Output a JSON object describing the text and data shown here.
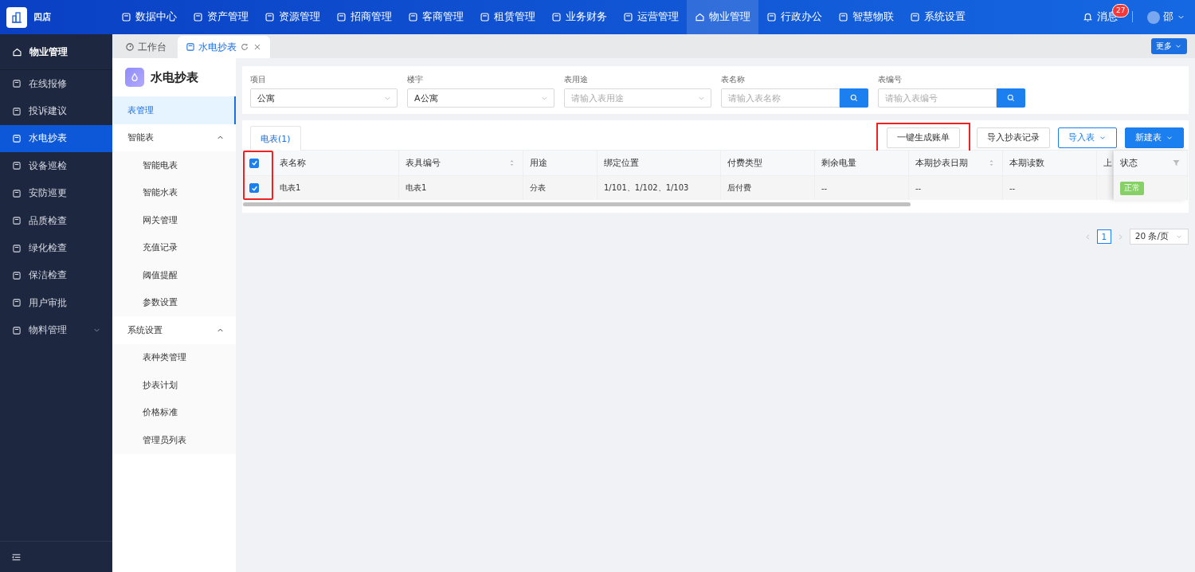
{
  "brand": {
    "name": "四店"
  },
  "top_nav": [
    {
      "label": "数据中心",
      "selected": false
    },
    {
      "label": "资产管理",
      "selected": false
    },
    {
      "label": "资源管理",
      "selected": false
    },
    {
      "label": "招商管理",
      "selected": false
    },
    {
      "label": "客商管理",
      "selected": false
    },
    {
      "label": "租赁管理",
      "selected": false
    },
    {
      "label": "业务财务",
      "selected": false
    },
    {
      "label": "运营管理",
      "selected": false
    },
    {
      "label": "物业管理",
      "selected": true
    },
    {
      "label": "行政办公",
      "selected": false
    },
    {
      "label": "智慧物联",
      "selected": false
    },
    {
      "label": "系统设置",
      "selected": false
    }
  ],
  "notifications": {
    "label": "消息",
    "count": "27"
  },
  "user": {
    "name": "邵"
  },
  "sidebar": {
    "title": "物业管理",
    "items": [
      {
        "label": "在线报修",
        "selected": false
      },
      {
        "label": "投诉建议",
        "selected": false
      },
      {
        "label": "水电抄表",
        "selected": true
      },
      {
        "label": "设备巡检",
        "selected": false
      },
      {
        "label": "安防巡更",
        "selected": false
      },
      {
        "label": "品质检查",
        "selected": false
      },
      {
        "label": "绿化检查",
        "selected": false
      },
      {
        "label": "保洁检查",
        "selected": false
      },
      {
        "label": "用户审批",
        "selected": false
      },
      {
        "label": "物料管理",
        "selected": false,
        "expanded": false
      }
    ]
  },
  "page_tabs": [
    {
      "label": "工作台",
      "selected": false
    },
    {
      "label": "水电抄表",
      "selected": true
    }
  ],
  "more_button": "更多",
  "submenu": {
    "title": "水电抄表",
    "items": [
      {
        "label": "表管理",
        "selected": true
      },
      {
        "label": "智能表",
        "selected": false,
        "expanded": true,
        "children": [
          {
            "label": "智能电表",
            "selected": false
          },
          {
            "label": "智能水表",
            "selected": false
          },
          {
            "label": "网关管理",
            "selected": false
          },
          {
            "label": "充值记录",
            "selected": false
          },
          {
            "label": "阈值提醒",
            "selected": false
          },
          {
            "label": "参数设置",
            "selected": false
          }
        ]
      },
      {
        "label": "系统设置",
        "selected": false,
        "expanded": true,
        "children": [
          {
            "label": "表种类管理",
            "selected": false
          },
          {
            "label": "抄表计划",
            "selected": false
          },
          {
            "label": "价格标准",
            "selected": false
          },
          {
            "label": "管理员列表",
            "selected": false
          }
        ]
      }
    ]
  },
  "filters": [
    {
      "label": "项目",
      "kind": "select",
      "value": "公寓"
    },
    {
      "label": "楼宇",
      "kind": "select",
      "value": "A公寓"
    },
    {
      "label": "表用途",
      "kind": "select",
      "placeholder": "请输入表用途"
    },
    {
      "label": "表名称",
      "kind": "search",
      "placeholder": "请输入表名称"
    },
    {
      "label": "表编号",
      "kind": "search",
      "placeholder": "请输入表编号"
    }
  ],
  "table_tabs": [
    {
      "label": "电表(1)",
      "selected": true
    }
  ],
  "actions": [
    {
      "label": "一键生成账单",
      "kind": "default",
      "highlighted": true
    },
    {
      "label": "导入抄表记录",
      "kind": "default",
      "highlighted": false
    },
    {
      "label": "导入表",
      "kind": "outline-dropdown",
      "highlighted": false
    },
    {
      "label": "新建表",
      "kind": "primary-dropdown",
      "highlighted": false
    }
  ],
  "table": {
    "select_column_highlighted": true,
    "all_checked": true,
    "columns": [
      {
        "label": "表名称",
        "sortable": false
      },
      {
        "label": "表具编号",
        "sortable": true
      },
      {
        "label": "用途",
        "sortable": false
      },
      {
        "label": "绑定位置",
        "sortable": false
      },
      {
        "label": "付费类型",
        "sortable": false
      },
      {
        "label": "剩余电量",
        "sortable": false
      },
      {
        "label": "本期抄表日期",
        "sortable": true
      },
      {
        "label": "本期读数",
        "sortable": false
      },
      {
        "label": "上",
        "sortable": false
      }
    ],
    "status_column": "状态",
    "rows": [
      {
        "checked": true,
        "cells": [
          "电表1",
          "电表1",
          "分表",
          "1/101、1/102、1/103",
          "后付费",
          "--",
          "--",
          "--"
        ],
        "status": "正常"
      }
    ]
  },
  "pagination": {
    "pages": [
      {
        "label": "1",
        "selected": true
      }
    ],
    "page_size": "20 条/页"
  }
}
